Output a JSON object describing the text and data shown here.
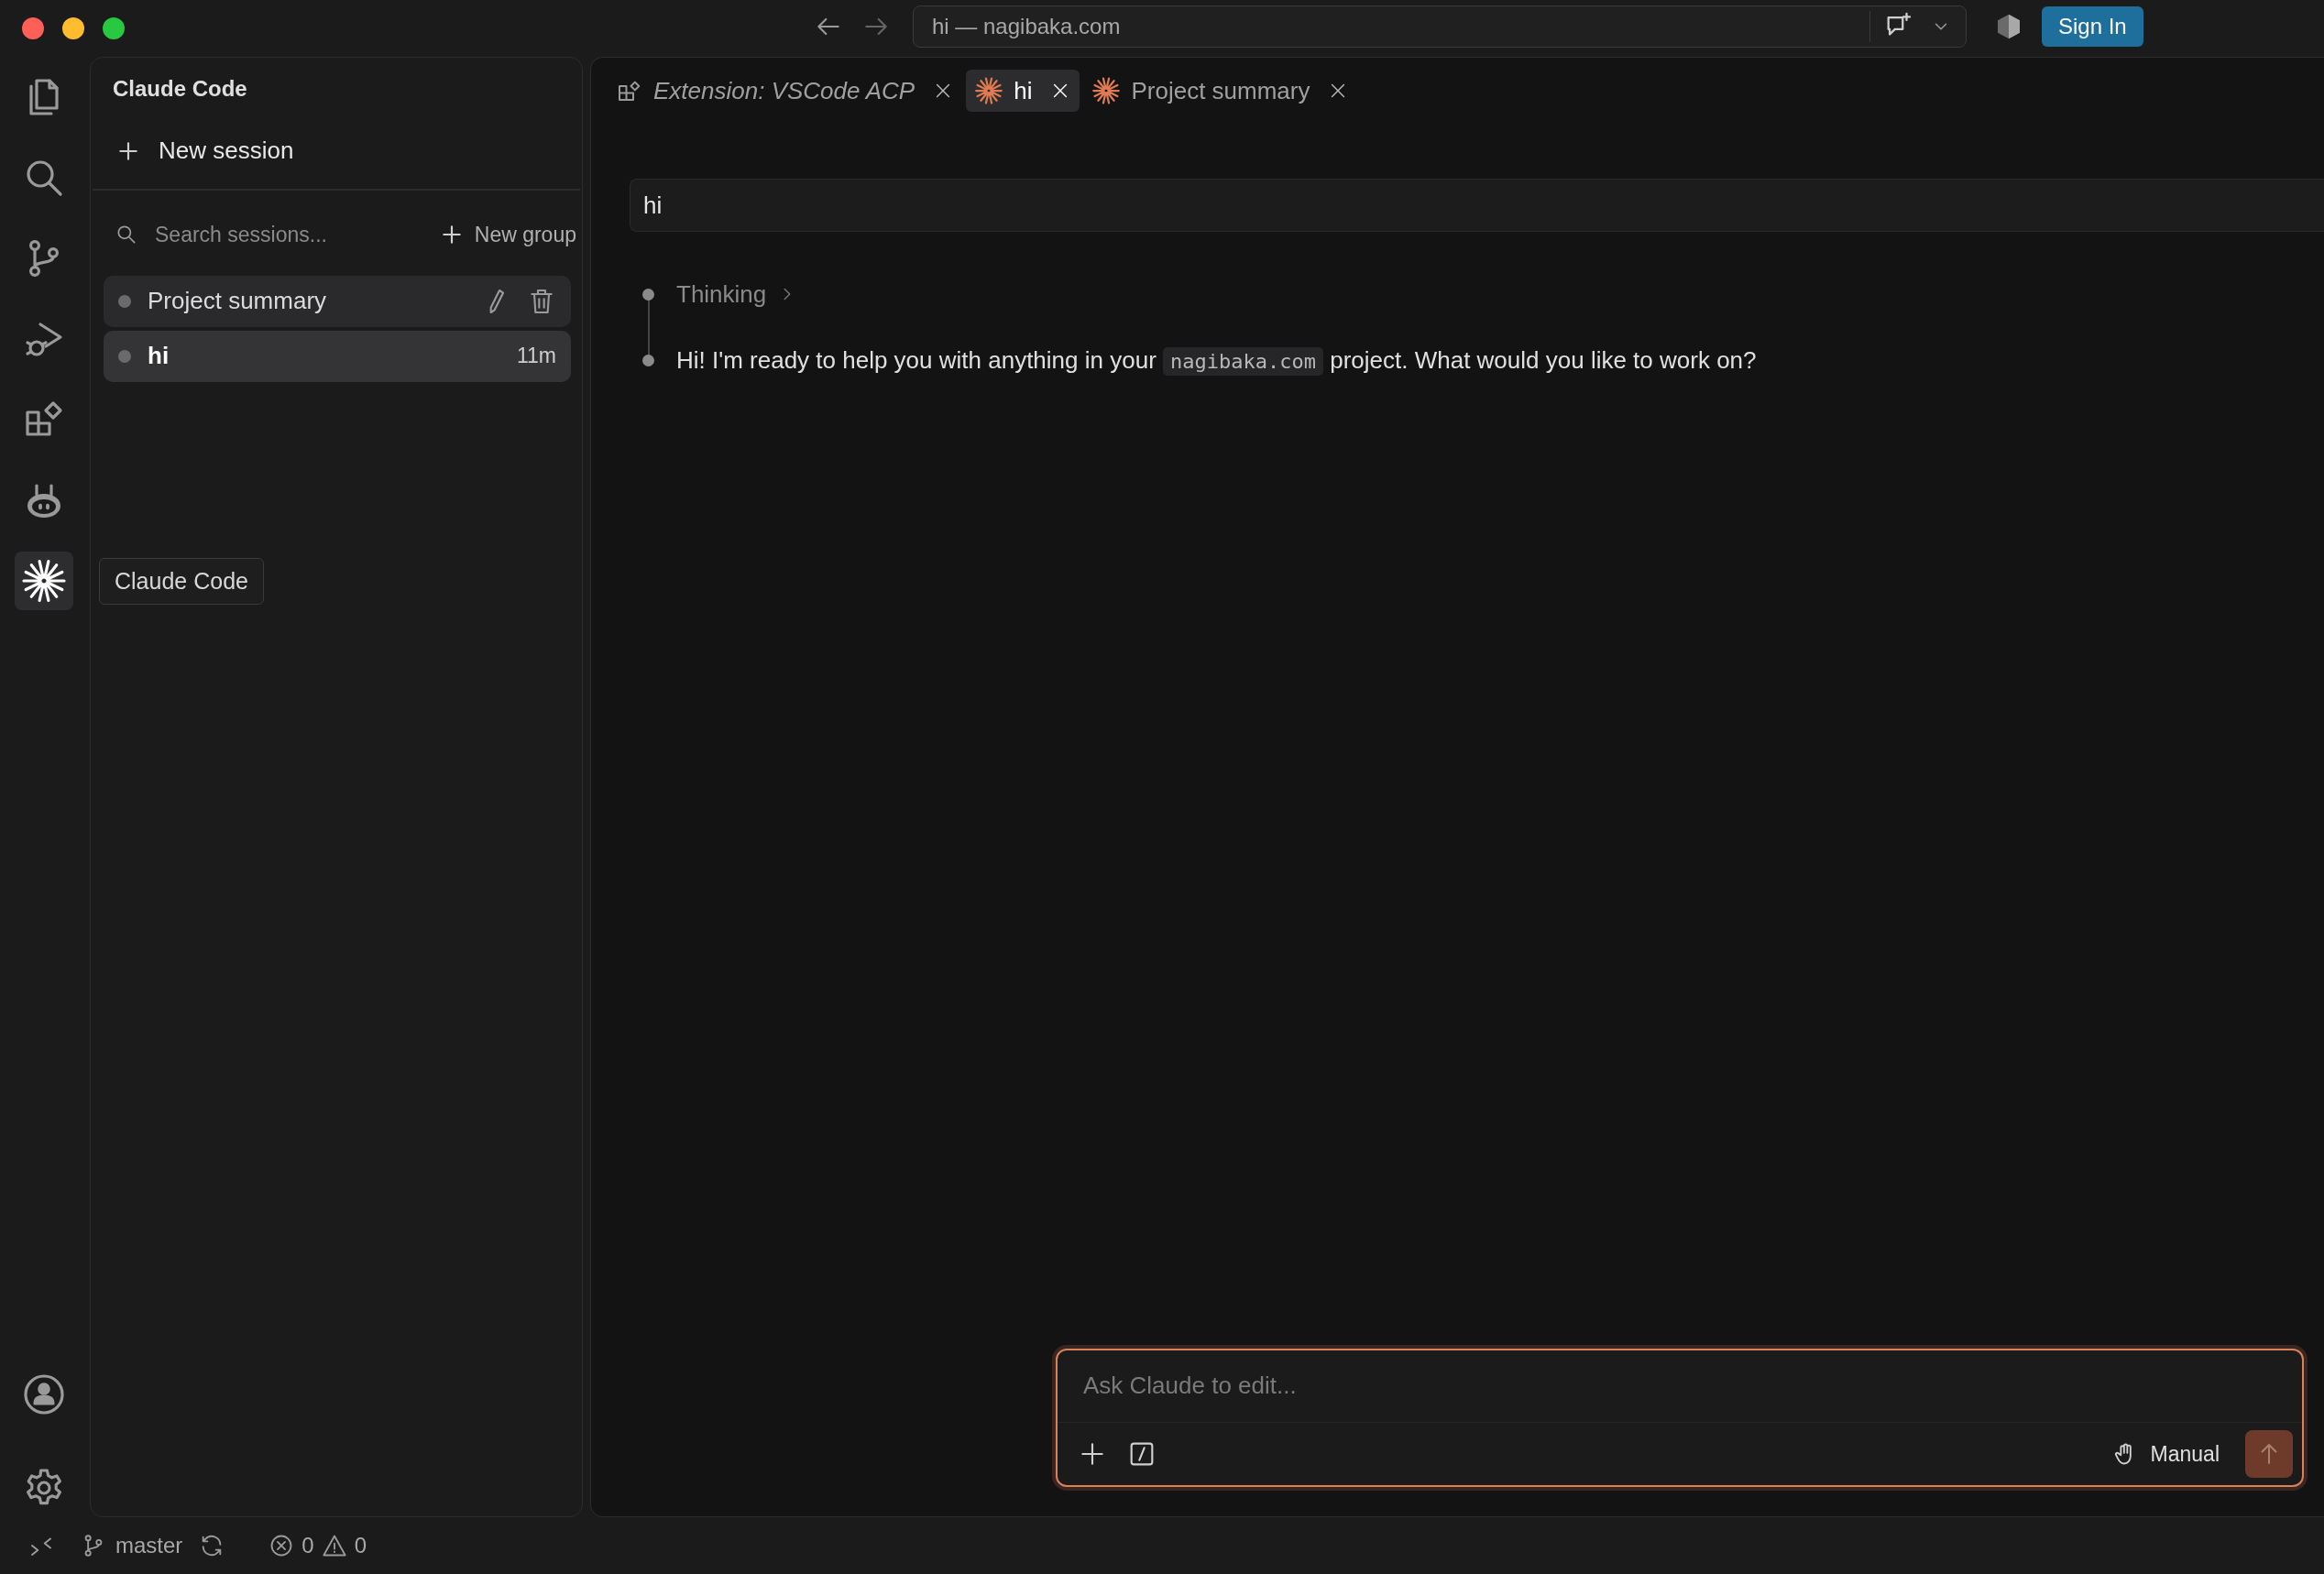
{
  "window": {
    "address": "hi — nagibaka.com",
    "sign_in": "Sign In"
  },
  "activity_bar": {
    "items": [
      {
        "kind": "files",
        "selected": false
      },
      {
        "kind": "search",
        "selected": false
      },
      {
        "kind": "source-control",
        "selected": false
      },
      {
        "kind": "run-debug",
        "selected": false
      },
      {
        "kind": "extensions",
        "selected": false
      },
      {
        "kind": "robot",
        "selected": false
      },
      {
        "kind": "claude",
        "selected": true
      }
    ],
    "tooltip": "Claude Code",
    "bottom": [
      {
        "kind": "account"
      },
      {
        "kind": "settings"
      }
    ]
  },
  "sidebar": {
    "title": "Claude Code",
    "new_session": "New session",
    "search": {
      "placeholder": "Search sessions..."
    },
    "new_group": "New group",
    "sessions": [
      {
        "title": "Project summary",
        "selected": false,
        "hovered": true
      },
      {
        "title": "hi",
        "time": "11m",
        "selected": true,
        "hovered": false
      }
    ]
  },
  "tabs": [
    {
      "label": "Extension: VSCode ACP",
      "kind": "extension",
      "preview": true,
      "selected": false
    },
    {
      "label": "hi",
      "kind": "claude",
      "preview": false,
      "selected": true
    },
    {
      "label": "Project summary",
      "kind": "claude",
      "preview": false,
      "selected": false
    }
  ],
  "chat": {
    "user_message": "hi",
    "steps": [
      {
        "kind": "thinking",
        "text": "Thinking"
      },
      {
        "kind": "message",
        "parts": [
          {
            "kind": "text",
            "text": "Hi! I'm ready to help you with anything in your "
          },
          {
            "kind": "code",
            "text": "nagibaka.com"
          },
          {
            "kind": "text",
            "text": " project. What would you like to work on?"
          }
        ]
      }
    ]
  },
  "composer": {
    "placeholder": "Ask Claude to edit...",
    "mode": "Manual"
  },
  "status_bar": {
    "branch": "master",
    "errors": "0",
    "warnings": "0"
  }
}
